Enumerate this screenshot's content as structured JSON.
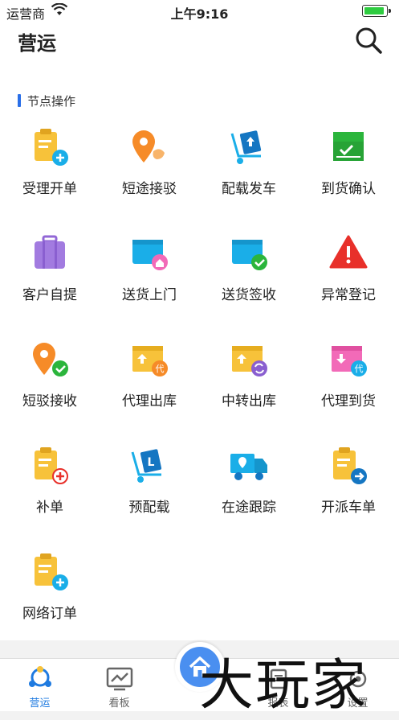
{
  "status_bar": {
    "carrier": "运营商",
    "time": "上午9:16"
  },
  "nav": {
    "title": "营运"
  },
  "section": {
    "title": "节点操作"
  },
  "grid_items": [
    {
      "label": "受理开单"
    },
    {
      "label": "短途接驳"
    },
    {
      "label": "配载发车"
    },
    {
      "label": "到货确认"
    },
    {
      "label": "客户自提"
    },
    {
      "label": "送货上门"
    },
    {
      "label": "送货签收"
    },
    {
      "label": "异常登记"
    },
    {
      "label": "短驳接收"
    },
    {
      "label": "代理出库"
    },
    {
      "label": "中转出库"
    },
    {
      "label": "代理到货"
    },
    {
      "label": "补单"
    },
    {
      "label": "预配载"
    },
    {
      "label": "在途跟踪"
    },
    {
      "label": "开派车单"
    },
    {
      "label": "网络订单"
    }
  ],
  "tabs": [
    {
      "label": "营运",
      "icon": "operations-icon",
      "active": true
    },
    {
      "label": "看板",
      "icon": "dashboard-icon",
      "active": false
    },
    {
      "label": "",
      "icon": "home-icon",
      "active": false
    },
    {
      "label": "报表",
      "icon": "report-icon",
      "active": false
    },
    {
      "label": "设置",
      "icon": "settings-icon",
      "active": false
    }
  ],
  "watermark": "大玩家",
  "colors": {
    "accent": "#1e7ae0",
    "yellow": "#f7c23a",
    "blue": "#1aaee8",
    "orange": "#f68b28",
    "green": "#2bb53c",
    "purple": "#a27be0",
    "red": "#e8302a",
    "pink": "#f26ab8"
  }
}
